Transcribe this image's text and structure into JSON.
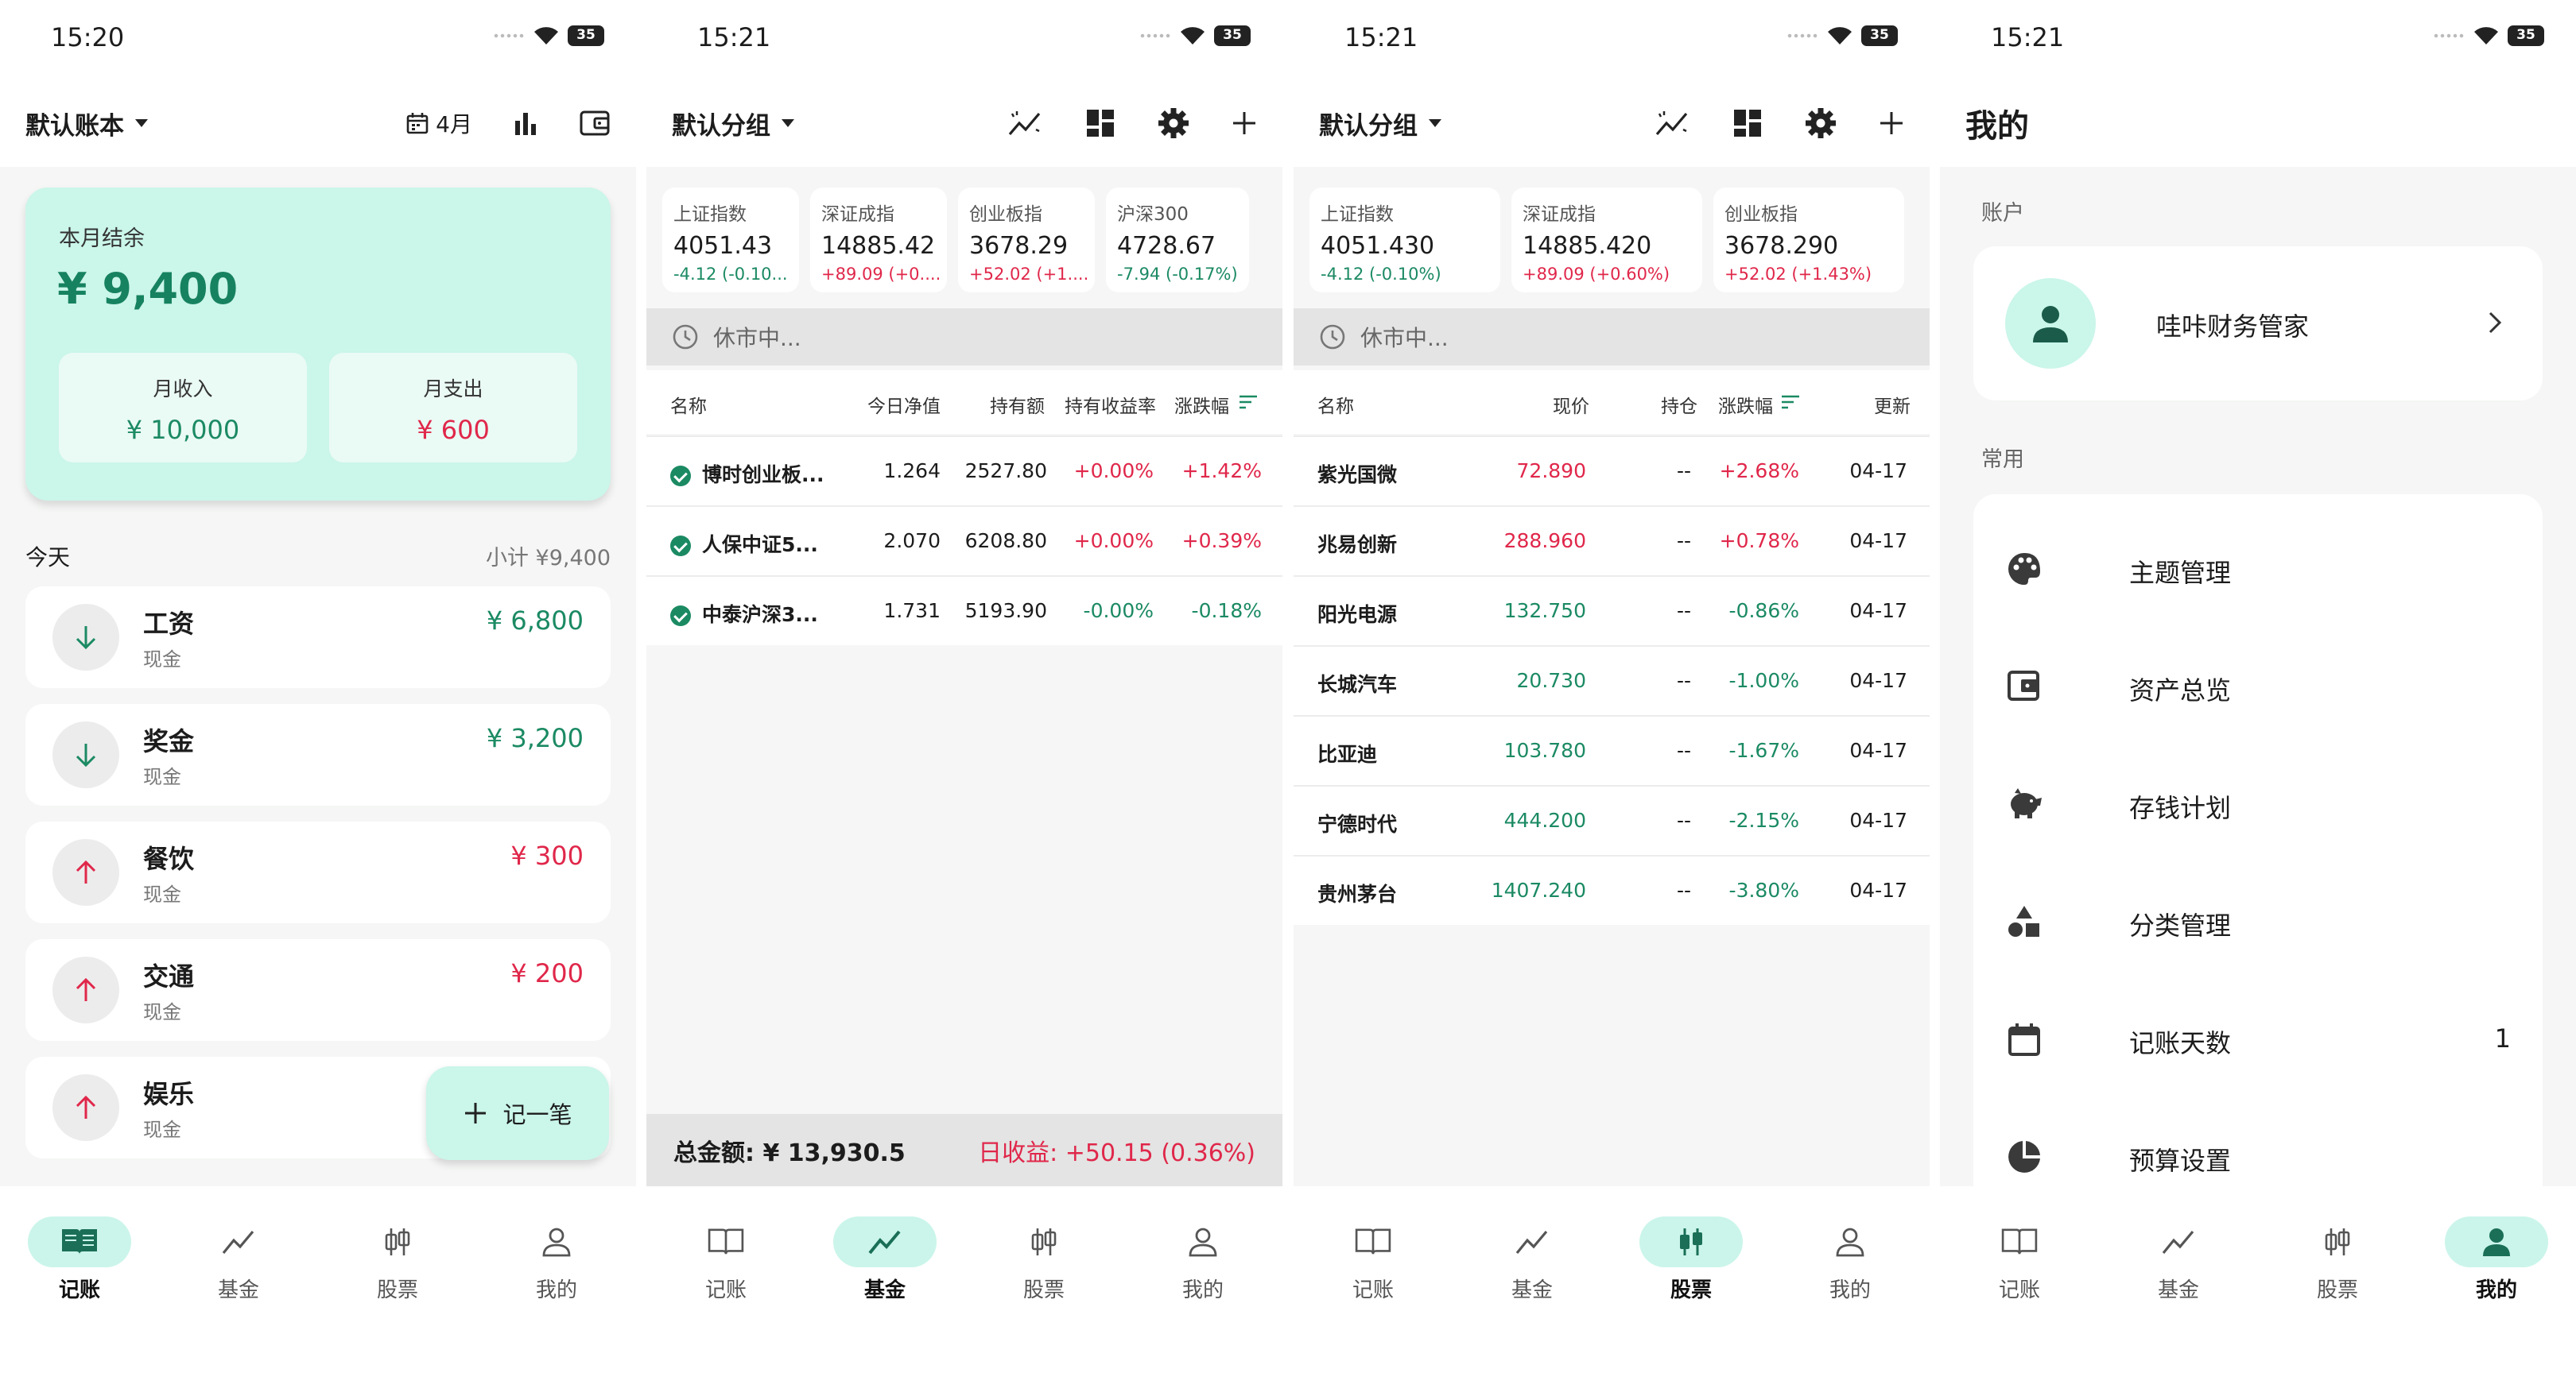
{
  "colors": {
    "accent": "#cbf6ea",
    "income_green": "#1b8a63",
    "expense_red": "#e0274a"
  },
  "status": {
    "time1": "15:20",
    "time2": "15:21",
    "time3": "15:21",
    "time4": "15:21",
    "battery": "35"
  },
  "nav": {
    "ledger": "记账",
    "fund": "基金",
    "stock": "股票",
    "mine": "我的"
  },
  "ledger": {
    "book_title": "默认账本",
    "month_label": "4月",
    "summary_label": "本月结余",
    "summary_value": "¥ 9,400",
    "income_label": "月收入",
    "income_value": "¥ 10,000",
    "expense_label": "月支出",
    "expense_value": "¥ 600",
    "today_label": "今天",
    "today_subtotal": "小计 ¥9,400",
    "transactions": [
      {
        "name": "工资",
        "account": "现金",
        "amount": "¥ 6,800",
        "type": "income"
      },
      {
        "name": "奖金",
        "account": "现金",
        "amount": "¥ 3,200",
        "type": "income"
      },
      {
        "name": "餐饮",
        "account": "现金",
        "amount": "¥ 300",
        "type": "expense"
      },
      {
        "name": "交通",
        "account": "现金",
        "amount": "¥ 200",
        "type": "expense"
      },
      {
        "name": "娱乐",
        "account": "现金",
        "amount": "",
        "type": "expense"
      }
    ],
    "fab_label": "记一笔"
  },
  "fund": {
    "group_title": "默认分组",
    "indices": [
      {
        "name": "上证指数",
        "value": "4051.43",
        "change": "-4.12 (-0.10...",
        "dir": "down"
      },
      {
        "name": "深证成指",
        "value": "14885.42",
        "change": "+89.09 (+0....",
        "dir": "up"
      },
      {
        "name": "创业板指",
        "value": "3678.29",
        "change": "+52.02 (+1....",
        "dir": "up"
      },
      {
        "name": "沪深300",
        "value": "4728.67",
        "change": "-7.94 (-0.17%)",
        "dir": "down"
      }
    ],
    "market_status": "休市中...",
    "headers": {
      "name": "名称",
      "nav": "今日净值",
      "holding": "持有额",
      "yield": "持有收益率",
      "change": "涨跌幅"
    },
    "rows": [
      {
        "name": "博时创业板...",
        "nav": "1.264",
        "holding": "2527.80",
        "yield": "+0.00%",
        "change": "+1.42%",
        "ydir": "up",
        "cdir": "up"
      },
      {
        "name": "人保中证5...",
        "nav": "2.070",
        "holding": "6208.80",
        "yield": "+0.00%",
        "change": "+0.39%",
        "ydir": "up",
        "cdir": "up"
      },
      {
        "name": "中泰沪深3...",
        "nav": "1.731",
        "holding": "5193.90",
        "yield": "-0.00%",
        "change": "-0.18%",
        "ydir": "down",
        "cdir": "down"
      }
    ],
    "total_label": "总金额: ¥ 13,930.5",
    "daily_gain": "日收益: +50.15 (0.36%)"
  },
  "stock": {
    "group_title": "默认分组",
    "indices": [
      {
        "name": "上证指数",
        "value": "4051.430",
        "change": "-4.12 (-0.10%)",
        "dir": "down"
      },
      {
        "name": "深证成指",
        "value": "14885.420",
        "change": "+89.09 (+0.60%)",
        "dir": "up"
      },
      {
        "name": "创业板指",
        "value": "3678.290",
        "change": "+52.02 (+1.43%)",
        "dir": "up"
      }
    ],
    "market_status": "休市中...",
    "headers": {
      "name": "名称",
      "price": "现价",
      "position": "持仓",
      "change": "涨跌幅",
      "updated": "更新"
    },
    "rows": [
      {
        "name": "紫光国微",
        "price": "72.890",
        "position": "--",
        "change": "+2.68%",
        "updated": "04-17",
        "dir": "up"
      },
      {
        "name": "兆易创新",
        "price": "288.960",
        "position": "--",
        "change": "+0.78%",
        "updated": "04-17",
        "dir": "up"
      },
      {
        "name": "阳光电源",
        "price": "132.750",
        "position": "--",
        "change": "-0.86%",
        "updated": "04-17",
        "dir": "down"
      },
      {
        "name": "长城汽车",
        "price": "20.730",
        "position": "--",
        "change": "-1.00%",
        "updated": "04-17",
        "dir": "down"
      },
      {
        "name": "比亚迪",
        "price": "103.780",
        "position": "--",
        "change": "-1.67%",
        "updated": "04-17",
        "dir": "down"
      },
      {
        "name": "宁德时代",
        "price": "444.200",
        "position": "--",
        "change": "-2.15%",
        "updated": "04-17",
        "dir": "down"
      },
      {
        "name": "贵州茅台",
        "price": "1407.240",
        "position": "--",
        "change": "-3.80%",
        "updated": "04-17",
        "dir": "down"
      }
    ]
  },
  "mine": {
    "title": "我的",
    "account_section": "账户",
    "account_name": "哇咔财务管家",
    "common_section": "常用",
    "menu": [
      {
        "label": "主题管理",
        "icon": "palette-icon",
        "value": ""
      },
      {
        "label": "资产总览",
        "icon": "wallet-icon",
        "value": ""
      },
      {
        "label": "存钱计划",
        "icon": "piggy-bank-icon",
        "value": ""
      },
      {
        "label": "分类管理",
        "icon": "category-icon",
        "value": ""
      },
      {
        "label": "记账天数",
        "icon": "calendar-icon",
        "value": "1"
      },
      {
        "label": "预算设置",
        "icon": "pie-chart-icon",
        "value": ""
      }
    ]
  }
}
